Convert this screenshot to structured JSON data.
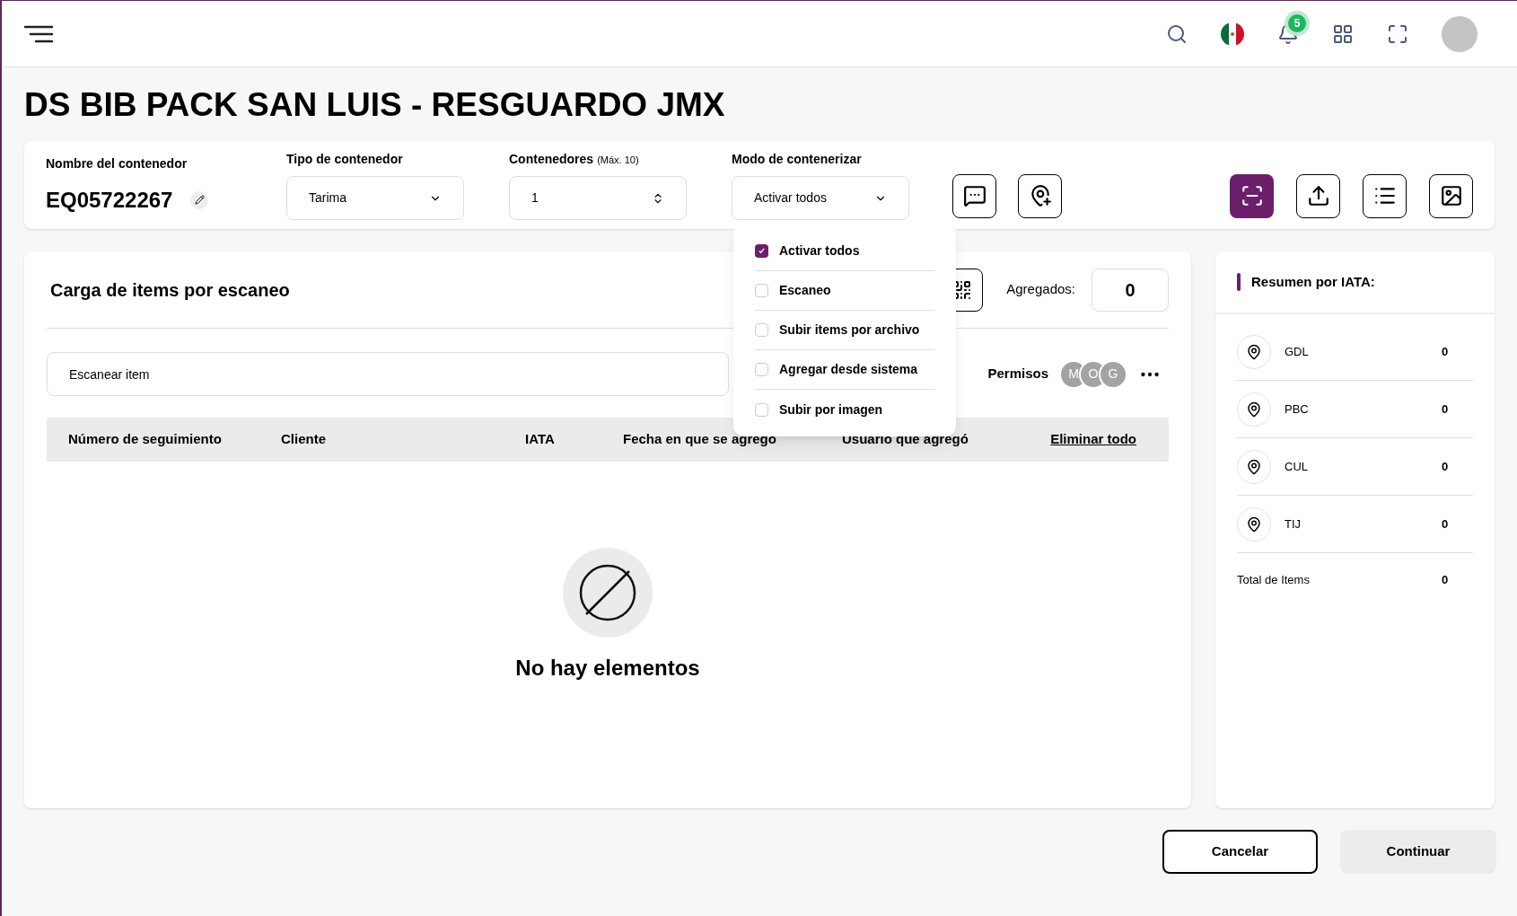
{
  "topbar": {
    "notification_count": "5"
  },
  "title": "DS BIB PACK SAN LUIS - RESGUARDO JMX",
  "form": {
    "name_label": "Nombre del contenedor",
    "name_value": "EQ05722267",
    "type_label": "Tipo de contenedor",
    "type_value": "Tarima",
    "count_label": "Contenedores",
    "count_hint": "(Máx. 10)",
    "count_value": "1",
    "mode_label": "Modo de contenerizar",
    "mode_value": "Activar todos"
  },
  "mode_options": [
    {
      "label": "Activar todos",
      "checked": true
    },
    {
      "label": "Escaneo",
      "checked": false
    },
    {
      "label": "Subir items por archivo",
      "checked": false
    },
    {
      "label": "Agregar desde sistema",
      "checked": false
    },
    {
      "label": "Subir por imagen",
      "checked": false
    }
  ],
  "scan": {
    "title": "Carga de items por escaneo",
    "added_label": "Agregados:",
    "added_value": "0",
    "input_placeholder": "Escanear item",
    "permissions_label": "Permisos",
    "permission_avatars": [
      "M",
      "O",
      "G"
    ]
  },
  "table": {
    "columns": [
      "Número de seguimiento",
      "Cliente",
      "IATA",
      "Fecha en que se agrego",
      "Usuario que agregó"
    ],
    "clear_all": "Eliminar todo",
    "empty_text": "No hay elementos"
  },
  "summary": {
    "title": "Resumen por IATA:",
    "rows": [
      {
        "code": "GDL",
        "count": "0"
      },
      {
        "code": "PBC",
        "count": "0"
      },
      {
        "code": "CUL",
        "count": "0"
      },
      {
        "code": "TIJ",
        "count": "0"
      }
    ],
    "total_label": "Total de Items",
    "total_value": "0"
  },
  "buttons": {
    "cancel": "Cancelar",
    "continue": "Continuar"
  }
}
